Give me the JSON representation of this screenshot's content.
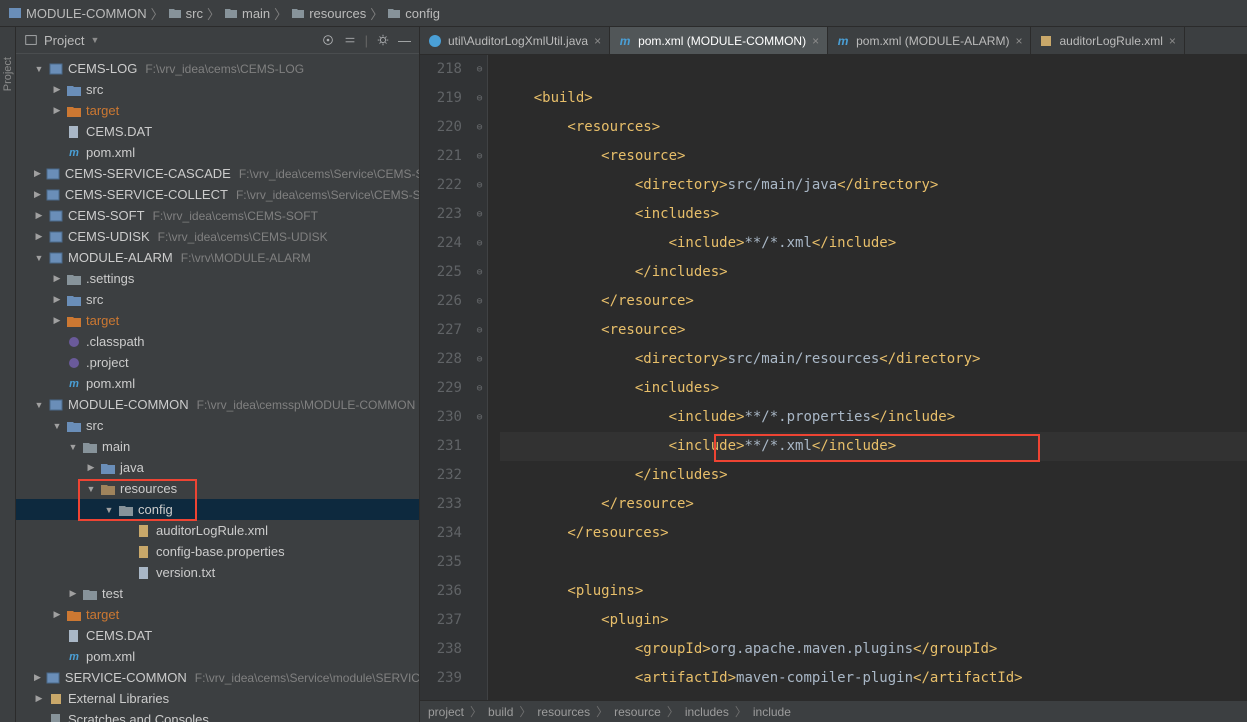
{
  "breadcrumb_top": [
    "MODULE-COMMON",
    "src",
    "main",
    "resources",
    "config"
  ],
  "project_panel": {
    "title": "Project"
  },
  "tree": [
    {
      "d": 1,
      "a": "▼",
      "i": "module",
      "l": "CEMS-LOG",
      "p": "F:\\vrv_idea\\cems\\CEMS-LOG"
    },
    {
      "d": 2,
      "a": "▶",
      "i": "src",
      "l": "src"
    },
    {
      "d": 2,
      "a": "▶",
      "i": "tgt",
      "l": "target",
      "cls": "tgt"
    },
    {
      "d": 2,
      "a": "",
      "i": "file",
      "l": "CEMS.DAT"
    },
    {
      "d": 2,
      "a": "",
      "i": "mvn",
      "l": "pom.xml"
    },
    {
      "d": 1,
      "a": "▶",
      "i": "module",
      "l": "CEMS-SERVICE-CASCADE",
      "p": "F:\\vrv_idea\\cems\\Service\\CEMS-SER"
    },
    {
      "d": 1,
      "a": "▶",
      "i": "module",
      "l": "CEMS-SERVICE-COLLECT",
      "p": "F:\\vrv_idea\\cems\\Service\\CEMS-SERV"
    },
    {
      "d": 1,
      "a": "▶",
      "i": "module",
      "l": "CEMS-SOFT",
      "p": "F:\\vrv_idea\\cems\\CEMS-SOFT"
    },
    {
      "d": 1,
      "a": "▶",
      "i": "module",
      "l": "CEMS-UDISK",
      "p": "F:\\vrv_idea\\cems\\CEMS-UDISK"
    },
    {
      "d": 1,
      "a": "▼",
      "i": "module",
      "l": "MODULE-ALARM",
      "p": "F:\\vrv\\MODULE-ALARM"
    },
    {
      "d": 2,
      "a": "▶",
      "i": "fld",
      "l": ".settings"
    },
    {
      "d": 2,
      "a": "▶",
      "i": "src",
      "l": "src"
    },
    {
      "d": 2,
      "a": "▶",
      "i": "tgt",
      "l": "target",
      "cls": "tgt"
    },
    {
      "d": 2,
      "a": "",
      "i": "ecl",
      "l": ".classpath"
    },
    {
      "d": 2,
      "a": "",
      "i": "ecl",
      "l": ".project"
    },
    {
      "d": 2,
      "a": "",
      "i": "mvn",
      "l": "pom.xml"
    },
    {
      "d": 1,
      "a": "▼",
      "i": "module",
      "l": "MODULE-COMMON",
      "p": "F:\\vrv_idea\\cemssp\\MODULE-COMMON"
    },
    {
      "d": 2,
      "a": "▼",
      "i": "src",
      "l": "src"
    },
    {
      "d": 3,
      "a": "▼",
      "i": "fld",
      "l": "main"
    },
    {
      "d": 4,
      "a": "▶",
      "i": "src",
      "l": "java"
    },
    {
      "d": 4,
      "a": "▼",
      "i": "res",
      "l": "resources"
    },
    {
      "d": 5,
      "a": "▼",
      "i": "fld",
      "l": "config",
      "sel": true
    },
    {
      "d": 6,
      "a": "",
      "i": "xml",
      "l": "auditorLogRule.xml"
    },
    {
      "d": 6,
      "a": "",
      "i": "prop",
      "l": "config-base.properties"
    },
    {
      "d": 6,
      "a": "",
      "i": "txt",
      "l": "version.txt"
    },
    {
      "d": 3,
      "a": "▶",
      "i": "fld",
      "l": "test"
    },
    {
      "d": 2,
      "a": "▶",
      "i": "tgt",
      "l": "target",
      "cls": "tgt"
    },
    {
      "d": 2,
      "a": "",
      "i": "file",
      "l": "CEMS.DAT"
    },
    {
      "d": 2,
      "a": "",
      "i": "mvn",
      "l": "pom.xml"
    },
    {
      "d": 1,
      "a": "▶",
      "i": "module",
      "l": "SERVICE-COMMON",
      "p": "F:\\vrv_idea\\cems\\Service\\module\\SERVICE"
    },
    {
      "d": 1,
      "a": "▶",
      "i": "lib",
      "l": "External Libraries"
    },
    {
      "d": 1,
      "a": "",
      "i": "scr",
      "l": "Scratches and Consoles"
    }
  ],
  "tabs": [
    {
      "icon": "java",
      "label": "util\\AuditorLogXmlUtil.java",
      "active": false,
      "close": true
    },
    {
      "icon": "mvn",
      "label": "pom.xml (MODULE-COMMON)",
      "active": true,
      "close": true
    },
    {
      "icon": "mvn",
      "label": "pom.xml (MODULE-ALARM)",
      "active": false,
      "close": true
    },
    {
      "icon": "xml",
      "label": "auditorLogRule.xml",
      "active": false,
      "close": true
    }
  ],
  "code": {
    "first_line": 218,
    "lines": [
      {
        "n": 218,
        "f": "",
        "s": []
      },
      {
        "n": 219,
        "f": "⊖",
        "s": [
          {
            "t": "tag",
            "v": "    <build>"
          }
        ]
      },
      {
        "n": 220,
        "f": "⊖",
        "s": [
          {
            "t": "tag",
            "v": "        <resources>"
          }
        ]
      },
      {
        "n": 221,
        "f": "⊖",
        "s": [
          {
            "t": "tag",
            "v": "            <resource>"
          }
        ]
      },
      {
        "n": 222,
        "f": "",
        "s": [
          {
            "t": "tag",
            "v": "                <directory>"
          },
          {
            "t": "txt",
            "v": "src/main/java"
          },
          {
            "t": "tag",
            "v": "</directory>"
          }
        ]
      },
      {
        "n": 223,
        "f": "⊖",
        "s": [
          {
            "t": "tag",
            "v": "                <includes>"
          }
        ]
      },
      {
        "n": 224,
        "f": "",
        "s": [
          {
            "t": "tag",
            "v": "                    <include>"
          },
          {
            "t": "txt",
            "v": "**/*.xml"
          },
          {
            "t": "tag",
            "v": "</include>"
          }
        ]
      },
      {
        "n": 225,
        "f": "⊖",
        "s": [
          {
            "t": "tag",
            "v": "                </includes>"
          }
        ]
      },
      {
        "n": 226,
        "f": "⊖",
        "s": [
          {
            "t": "tag",
            "v": "            </resource>"
          }
        ]
      },
      {
        "n": 227,
        "f": "⊖",
        "s": [
          {
            "t": "tag",
            "v": "            <resource>"
          }
        ]
      },
      {
        "n": 228,
        "f": "",
        "s": [
          {
            "t": "tag",
            "v": "                <directory>"
          },
          {
            "t": "txt",
            "v": "src/main/resources"
          },
          {
            "t": "tag",
            "v": "</directory>"
          }
        ]
      },
      {
        "n": 229,
        "f": "⊖",
        "s": [
          {
            "t": "tag",
            "v": "                <includes>"
          }
        ]
      },
      {
        "n": 230,
        "f": "",
        "s": [
          {
            "t": "tag",
            "v": "                    <include>"
          },
          {
            "t": "txt",
            "v": "**/*.properties"
          },
          {
            "t": "tag",
            "v": "</include>"
          }
        ]
      },
      {
        "n": 231,
        "f": "",
        "hl": true,
        "s": [
          {
            "t": "tag",
            "v": "                    <include>"
          },
          {
            "t": "txt",
            "v": "**/*.xml"
          },
          {
            "t": "tag",
            "v": "</include>"
          }
        ]
      },
      {
        "n": 232,
        "f": "⊖",
        "s": [
          {
            "t": "tag",
            "v": "                </includes>"
          }
        ]
      },
      {
        "n": 233,
        "f": "⊖",
        "s": [
          {
            "t": "tag",
            "v": "            </resource>"
          }
        ]
      },
      {
        "n": 234,
        "f": "⊖",
        "s": [
          {
            "t": "tag",
            "v": "        </resources>"
          }
        ]
      },
      {
        "n": 235,
        "f": "",
        "s": []
      },
      {
        "n": 236,
        "f": "⊖",
        "s": [
          {
            "t": "tag",
            "v": "        <plugins>"
          }
        ]
      },
      {
        "n": 237,
        "f": "⊖",
        "s": [
          {
            "t": "tag",
            "v": "            <plugin>"
          }
        ]
      },
      {
        "n": 238,
        "f": "",
        "s": [
          {
            "t": "tag",
            "v": "                <groupId>"
          },
          {
            "t": "txt",
            "v": "org.apache.maven.plugins"
          },
          {
            "t": "tag",
            "v": "</groupId>"
          }
        ]
      },
      {
        "n": 239,
        "f": "",
        "s": [
          {
            "t": "tag",
            "v": "                <artifactId>"
          },
          {
            "t": "txt",
            "v": "maven-compiler-plugin"
          },
          {
            "t": "tag",
            "v": "</artifactId>"
          }
        ]
      }
    ]
  },
  "breadcrumb_bottom": [
    "project",
    "build",
    "resources",
    "resource",
    "includes",
    "include"
  ]
}
